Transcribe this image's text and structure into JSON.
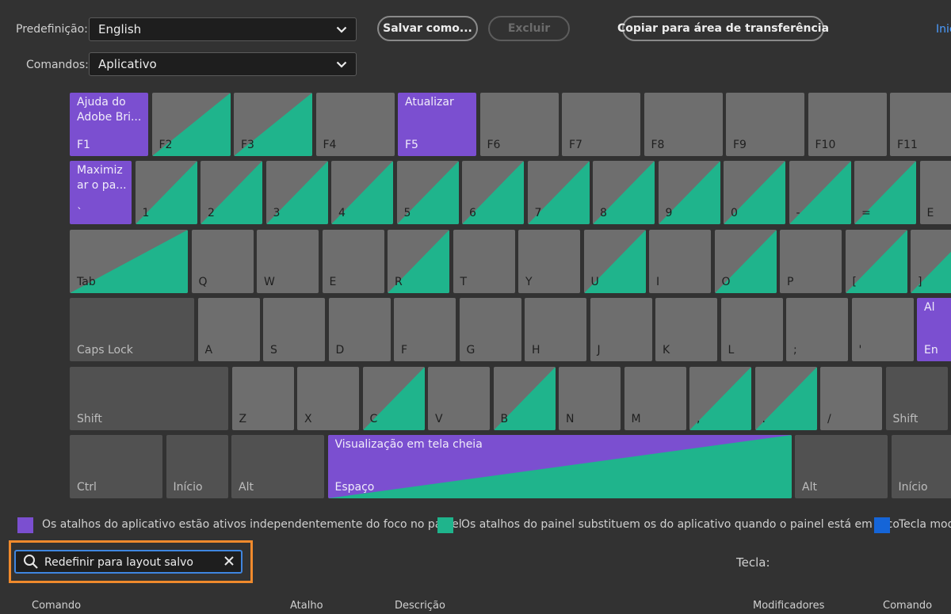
{
  "preset": {
    "label": "Predefinição:",
    "value": "English"
  },
  "commands": {
    "label": "Comandos:",
    "value": "Aplicativo"
  },
  "buttons": {
    "save_as": "Salvar como...",
    "delete": "Excluir",
    "copy": "Copiar para área de transferência"
  },
  "top_link": "Inic",
  "colors": {
    "app_shortcut": "#7b4fd0",
    "panel_shortcut": "#1fb48c",
    "modifier": "#1565d8",
    "key": "#6e6e6e",
    "key_dark": "#515151",
    "focus_outline": "#f08a2c"
  },
  "keyboard": {
    "rows": [
      [
        {
          "name": "F1",
          "type": "purple",
          "cmd": "Ajuda do\nAdobe Bri..."
        },
        {
          "name": "F2",
          "type": "split"
        },
        {
          "name": "F3",
          "type": "split"
        },
        {
          "name": "F4",
          "type": "gray"
        },
        {
          "name": "F5",
          "type": "purple",
          "cmd": "Atualizar"
        },
        {
          "name": "F6",
          "type": "gray"
        },
        {
          "name": "F7",
          "type": "gray"
        },
        {
          "name": "F8",
          "type": "gray"
        },
        {
          "name": "F9",
          "type": "gray"
        },
        {
          "name": "F10",
          "type": "gray"
        },
        {
          "name": "F11",
          "type": "gray"
        }
      ],
      [
        {
          "name": "`",
          "type": "purple",
          "cmd": "Maximiz\nar o pa..."
        },
        {
          "name": "1",
          "type": "split"
        },
        {
          "name": "2",
          "type": "split"
        },
        {
          "name": "3",
          "type": "split"
        },
        {
          "name": "4",
          "type": "split"
        },
        {
          "name": "5",
          "type": "split"
        },
        {
          "name": "6",
          "type": "split"
        },
        {
          "name": "7",
          "type": "split"
        },
        {
          "name": "8",
          "type": "split"
        },
        {
          "name": "9",
          "type": "split"
        },
        {
          "name": "0",
          "type": "split"
        },
        {
          "name": "-",
          "type": "split"
        },
        {
          "name": "=",
          "type": "split"
        },
        {
          "name": "E",
          "type": "gray"
        }
      ],
      [
        {
          "name": "Tab",
          "type": "split"
        },
        {
          "name": "Q",
          "type": "gray"
        },
        {
          "name": "W",
          "type": "gray"
        },
        {
          "name": "E",
          "type": "gray"
        },
        {
          "name": "R",
          "type": "split"
        },
        {
          "name": "T",
          "type": "gray"
        },
        {
          "name": "Y",
          "type": "gray"
        },
        {
          "name": "U",
          "type": "split"
        },
        {
          "name": "I",
          "type": "gray"
        },
        {
          "name": "O",
          "type": "split"
        },
        {
          "name": "P",
          "type": "gray"
        },
        {
          "name": "[",
          "type": "split"
        },
        {
          "name": "]",
          "type": "split"
        }
      ],
      [
        {
          "name": "Caps Lock",
          "type": "dark"
        },
        {
          "name": "A",
          "type": "gray"
        },
        {
          "name": "S",
          "type": "gray"
        },
        {
          "name": "D",
          "type": "gray"
        },
        {
          "name": "F",
          "type": "gray"
        },
        {
          "name": "G",
          "type": "gray"
        },
        {
          "name": "H",
          "type": "gray"
        },
        {
          "name": "J",
          "type": "gray"
        },
        {
          "name": "K",
          "type": "gray"
        },
        {
          "name": "L",
          "type": "gray"
        },
        {
          "name": ";",
          "type": "gray"
        },
        {
          "name": "'",
          "type": "gray"
        },
        {
          "name": "En",
          "type": "purple",
          "cmd": "Al"
        }
      ],
      [
        {
          "name": "Shift",
          "type": "dark"
        },
        {
          "name": "Z",
          "type": "gray"
        },
        {
          "name": "X",
          "type": "gray"
        },
        {
          "name": "C",
          "type": "split"
        },
        {
          "name": "V",
          "type": "gray"
        },
        {
          "name": "B",
          "type": "split"
        },
        {
          "name": "N",
          "type": "gray"
        },
        {
          "name": "M",
          "type": "gray"
        },
        {
          "name": ",",
          "type": "split"
        },
        {
          "name": ".",
          "type": "split"
        },
        {
          "name": "/",
          "type": "gray"
        },
        {
          "name": "Shift",
          "type": "dark"
        }
      ],
      [
        {
          "name": "Ctrl",
          "type": "dark"
        },
        {
          "name": "Início",
          "type": "dark"
        },
        {
          "name": "Alt",
          "type": "dark"
        },
        {
          "name": "Espaço",
          "type": "space",
          "cmd": "Visualização em tela cheia"
        },
        {
          "name": "Alt",
          "type": "dark"
        },
        {
          "name": "Início",
          "type": "dark"
        }
      ]
    ]
  },
  "legend": [
    {
      "color": "#7b4fd0",
      "text": "Os atalhos do aplicativo estão ativos independentemente do foco no painel"
    },
    {
      "color": "#1fb48c",
      "text": "Os atalhos do painel substituem os do aplicativo quando o painel está em foco"
    },
    {
      "color": "#1565d8",
      "text": "Tecla mod"
    }
  ],
  "search": {
    "value": "Redefinir para layout salvo",
    "icon": "search-icon",
    "clear_icon": "close-icon"
  },
  "tecla_label": "Tecla:",
  "columns": {
    "command": "Comando",
    "shortcut": "Atalho",
    "description": "Descrição",
    "modifiers": "Modificadores",
    "command2": "Comando"
  }
}
